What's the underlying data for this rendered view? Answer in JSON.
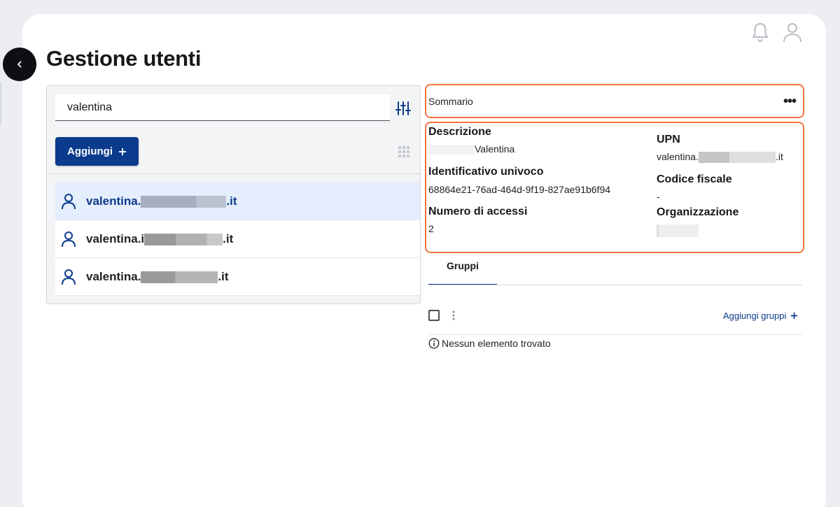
{
  "page": {
    "title": "Gestione utenti"
  },
  "header": {
    "icons": [
      "bell-icon",
      "user-icon"
    ]
  },
  "search": {
    "value": "valentina"
  },
  "toolbar": {
    "add_label": "Aggiungi"
  },
  "users": [
    {
      "prefix": "valentina.",
      "suffix": ".it",
      "selected": true
    },
    {
      "prefix": "valentina.i",
      "suffix": ".it",
      "selected": false
    },
    {
      "prefix": "valentina.",
      "suffix": ".it",
      "selected": false
    }
  ],
  "summary": {
    "label": "Sommario"
  },
  "details": {
    "descrizione_label": "Descrizione",
    "descrizione_value": "Valentina",
    "upn_label": "UPN",
    "upn_prefix": "valentina.",
    "upn_suffix": ".it",
    "id_label": "Identificativo univoco",
    "id_value": "68864e21-76ad-464d-9f19-827ae91b6f94",
    "codice_label": "Codice fiscale",
    "codice_value": "-",
    "accessi_label": "Numero di accessi",
    "accessi_value": "2",
    "org_label": "Organizzazione"
  },
  "tabs": [
    {
      "label": "Gruppi",
      "active": true
    }
  ],
  "groups": {
    "add_label": "Aggiungi gruppi",
    "empty_text": "Nessun elemento trovato"
  },
  "colors": {
    "accent": "#0b3b8c",
    "highlight_border": "#f0743f",
    "selected_row": "#e4eefc"
  }
}
